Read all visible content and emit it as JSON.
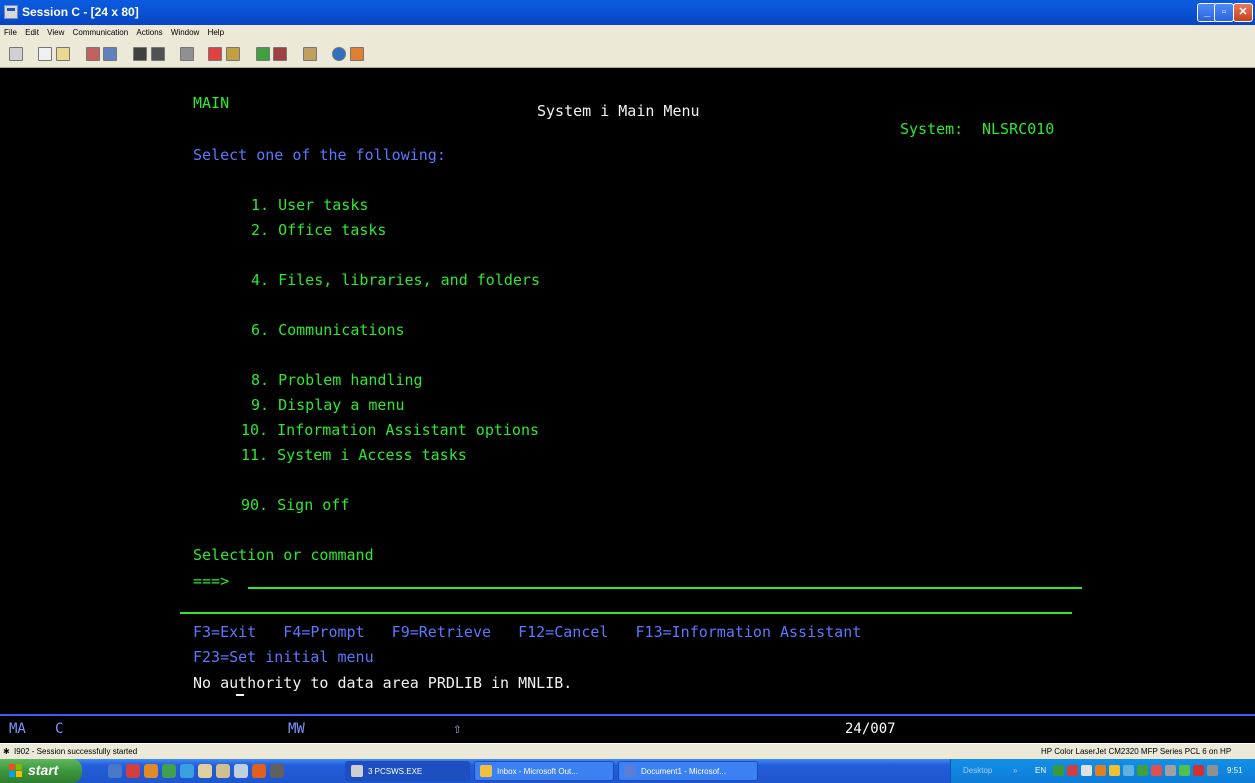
{
  "window": {
    "title": "Session C - [24 x 80]",
    "icon": "session-icon"
  },
  "menu": [
    "File",
    "Edit",
    "View",
    "Communication",
    "Actions",
    "Window",
    "Help"
  ],
  "terminal": {
    "menu_id": "MAIN",
    "screen_title": "System i Main Menu",
    "system_label": "System:",
    "system_name": "NLSRC010",
    "instruction": "Select one of the following:",
    "options": [
      {
        "text": "1. User tasks"
      },
      {
        "text": "2. Office tasks"
      },
      {
        "text": "4. Files, libraries, and folders"
      },
      {
        "text": "6. Communications"
      },
      {
        "text": "8. Problem handling"
      },
      {
        "text": "9. Display a menu"
      },
      {
        "text": "10. Information Assistant options"
      },
      {
        "text": "11. System i Access tasks"
      },
      {
        "text": "90. Sign off"
      }
    ],
    "selection_label": "Selection or command",
    "prompt": "===>",
    "command_value": "",
    "fkeys_line1": "F3=Exit   F4=Prompt   F9=Retrieve   F12=Cancel   F13=Information Assistant",
    "fkeys_line2": "F23=Set initial menu",
    "message": "No authority to data area PRDLIB in MNLIB."
  },
  "oia": {
    "mode": "MA",
    "session": "C",
    "mw": "MW",
    "shift_icon": "⇧",
    "cursor_pos": "24/007"
  },
  "statusbar": {
    "left": "I902 - Session successfully started",
    "right": "HP Color LaserJet CM2320 MFP Series PCL 6 on HP"
  },
  "taskbar": {
    "start_label": "start",
    "buttons": [
      {
        "label": "3 PCSWS.EXE"
      },
      {
        "label": "Inbox - Microsoft Out..."
      },
      {
        "label": "Document1 - Microsof..."
      }
    ],
    "tray": {
      "desktop": "Desktop",
      "lang": "EN",
      "time": "9:51"
    }
  }
}
